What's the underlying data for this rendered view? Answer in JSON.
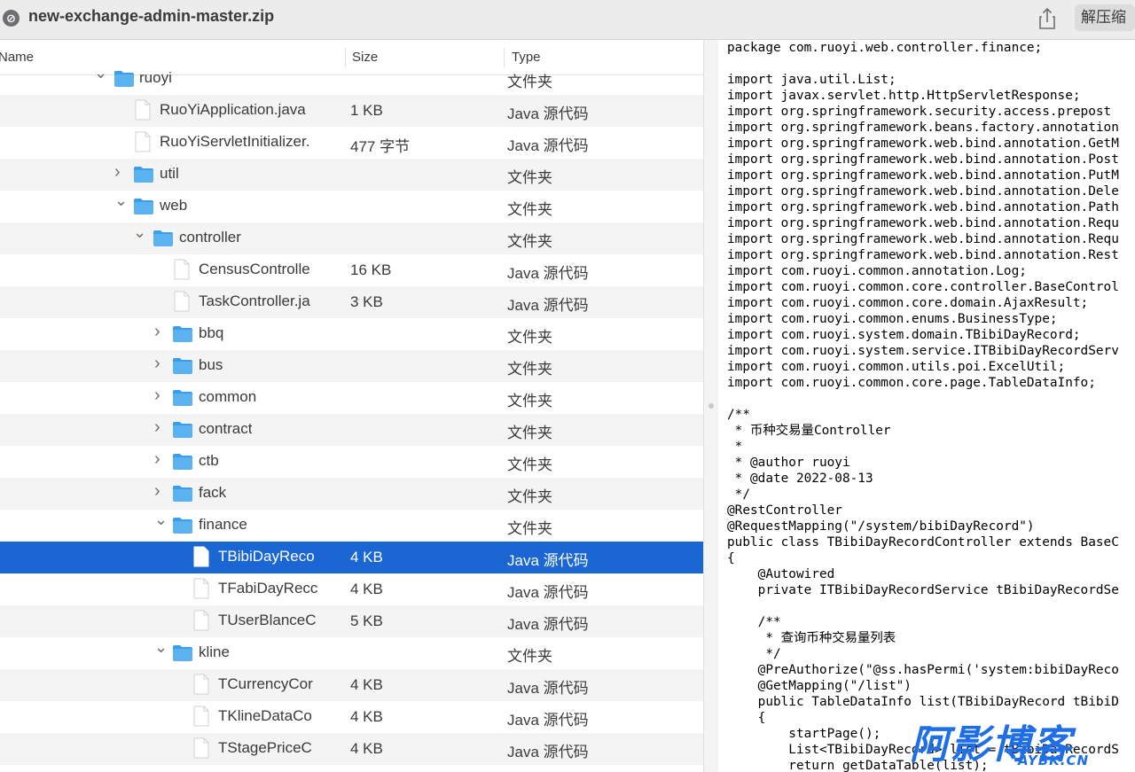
{
  "window": {
    "title": "new-exchange-admin-master.zip",
    "unzip_label": "解压缩",
    "share_icon": "share-icon",
    "app_icon": "archive-app-icon"
  },
  "columns": {
    "name": "Name",
    "size": "Size",
    "type": "Type"
  },
  "rows": [
    {
      "name": "ruoyi",
      "size": "",
      "type": "文件夹",
      "kind": "folder",
      "depth": 0,
      "expanded": true
    },
    {
      "name": "RuoYiApplication.java",
      "size": "1 KB",
      "type": "Java 源代码",
      "kind": "file",
      "depth": 1
    },
    {
      "name": "RuoYiServletInitializer.",
      "size": "477 字节",
      "type": "Java 源代码",
      "kind": "file",
      "depth": 1
    },
    {
      "name": "util",
      "size": "",
      "type": "文件夹",
      "kind": "folder",
      "depth": 1,
      "expanded": false
    },
    {
      "name": "web",
      "size": "",
      "type": "文件夹",
      "kind": "folder",
      "depth": 1,
      "expanded": true
    },
    {
      "name": "controller",
      "size": "",
      "type": "文件夹",
      "kind": "folder",
      "depth": 2,
      "expanded": true
    },
    {
      "name": "CensusControlle",
      "size": "16 KB",
      "type": "Java 源代码",
      "kind": "file",
      "depth": 3
    },
    {
      "name": "TaskController.ja",
      "size": "3 KB",
      "type": "Java 源代码",
      "kind": "file",
      "depth": 3
    },
    {
      "name": "bbq",
      "size": "",
      "type": "文件夹",
      "kind": "folder",
      "depth": 3,
      "expanded": false
    },
    {
      "name": "bus",
      "size": "",
      "type": "文件夹",
      "kind": "folder",
      "depth": 3,
      "expanded": false
    },
    {
      "name": "common",
      "size": "",
      "type": "文件夹",
      "kind": "folder",
      "depth": 3,
      "expanded": false
    },
    {
      "name": "contract",
      "size": "",
      "type": "文件夹",
      "kind": "folder",
      "depth": 3,
      "expanded": false
    },
    {
      "name": "ctb",
      "size": "",
      "type": "文件夹",
      "kind": "folder",
      "depth": 3,
      "expanded": false
    },
    {
      "name": "fack",
      "size": "",
      "type": "文件夹",
      "kind": "folder",
      "depth": 3,
      "expanded": false
    },
    {
      "name": "finance",
      "size": "",
      "type": "文件夹",
      "kind": "folder",
      "depth": 3,
      "expanded": true
    },
    {
      "name": "TBibiDayReco",
      "size": "4 KB",
      "type": "Java 源代码",
      "kind": "file",
      "depth": 4,
      "selected": true
    },
    {
      "name": "TFabiDayRecc",
      "size": "4 KB",
      "type": "Java 源代码",
      "kind": "file",
      "depth": 4
    },
    {
      "name": "TUserBlanceC",
      "size": "5 KB",
      "type": "Java 源代码",
      "kind": "file",
      "depth": 4
    },
    {
      "name": "kline",
      "size": "",
      "type": "文件夹",
      "kind": "folder",
      "depth": 3,
      "expanded": true
    },
    {
      "name": "TCurrencyCor",
      "size": "4 KB",
      "type": "Java 源代码",
      "kind": "file",
      "depth": 4
    },
    {
      "name": "TKlineDataCo",
      "size": "4 KB",
      "type": "Java 源代码",
      "kind": "file",
      "depth": 4
    },
    {
      "name": "TStagePriceC",
      "size": "4 KB",
      "type": "Java 源代码",
      "kind": "file",
      "depth": 4
    }
  ],
  "code_lines": [
    "package com.ruoyi.web.controller.finance;",
    "",
    "import java.util.List;",
    "import javax.servlet.http.HttpServletResponse;",
    "import org.springframework.security.access.prepost",
    "import org.springframework.beans.factory.annotation",
    "import org.springframework.web.bind.annotation.GetM",
    "import org.springframework.web.bind.annotation.Post",
    "import org.springframework.web.bind.annotation.PutM",
    "import org.springframework.web.bind.annotation.Dele",
    "import org.springframework.web.bind.annotation.Path",
    "import org.springframework.web.bind.annotation.Requ",
    "import org.springframework.web.bind.annotation.Requ",
    "import org.springframework.web.bind.annotation.Rest",
    "import com.ruoyi.common.annotation.Log;",
    "import com.ruoyi.common.core.controller.BaseControl",
    "import com.ruoyi.common.core.domain.AjaxResult;",
    "import com.ruoyi.common.enums.BusinessType;",
    "import com.ruoyi.system.domain.TBibiDayRecord;",
    "import com.ruoyi.system.service.ITBibiDayRecordServ",
    "import com.ruoyi.common.utils.poi.ExcelUtil;",
    "import com.ruoyi.common.core.page.TableDataInfo;",
    "",
    "/**",
    " * 币种交易量Controller",
    " *",
    " * @author ruoyi",
    " * @date 2022-08-13",
    " */",
    "@RestController",
    "@RequestMapping(\"/system/bibiDayRecord\")",
    "public class TBibiDayRecordController extends BaseC",
    "{",
    "    @Autowired",
    "    private ITBibiDayRecordService tBibiDayRecordSe",
    "",
    "    /**",
    "     * 查询币种交易量列表",
    "     */",
    "    @PreAuthorize(\"@ss.hasPermi('system:bibiDayReco",
    "    @GetMapping(\"/list\")",
    "    public TableDataInfo list(TBibiDayRecord tBibiD",
    "    {",
    "        startPage();",
    "        List<TBibiDayRecord> list = tBibiDayRecordS",
    "        return getDataTable(list);"
  ],
  "watermark": {
    "big": "阿影博客",
    "small": "AYBK.CN"
  },
  "colors": {
    "selection": "#1a66d2",
    "folder": "#5ab3f0",
    "watermark": "#1e6ee8"
  }
}
